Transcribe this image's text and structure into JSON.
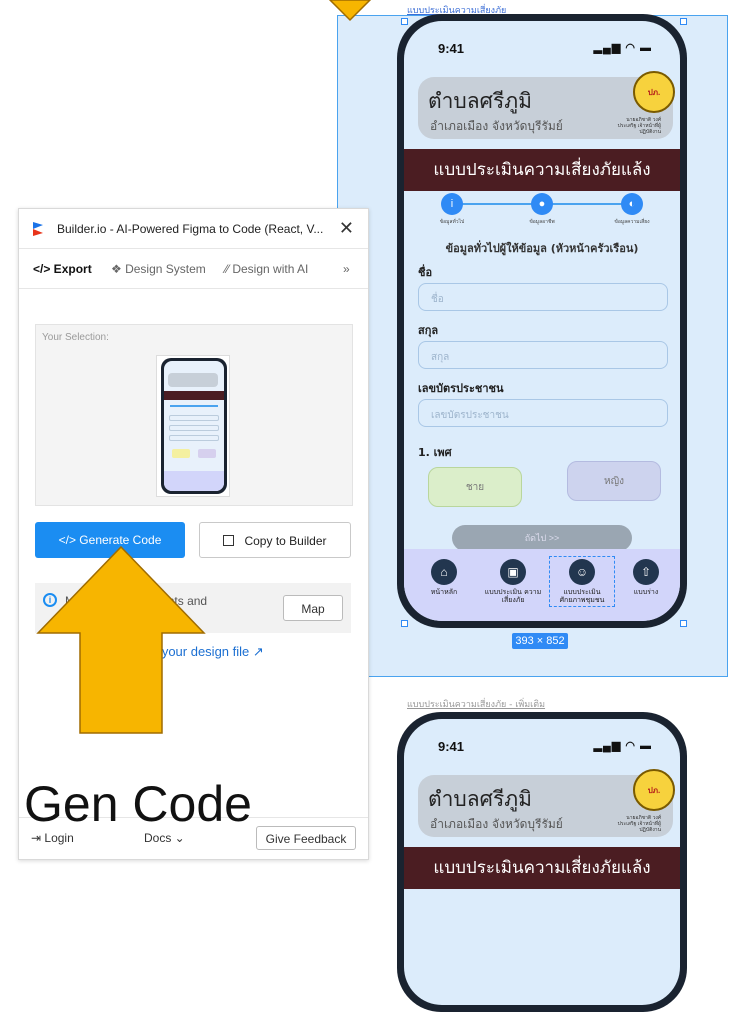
{
  "canvas": {
    "frame1_label": "แบบประเมินความเสี่ยงภัย",
    "frame2_label": "แบบประเมินความเสี่ยงภัย - เพิ่มเติม",
    "dimensions": "393 × 852"
  },
  "phone": {
    "status_time": "9:41",
    "status_icons": "▂▄▆ ◠ ▬",
    "header_title": "ตำบลศรีภูมิ",
    "header_sub": "อำเภอเมือง จังหวัดบุรีรัมย์",
    "header_note": "นายอภิชาติ วงศ์ประเสริฐ เจ้าหน้าที่ผู้ปฏิบัติงาน",
    "logo_text": "ปภ.",
    "banner": "แบบประเมินความเสี่ยงภัยแล้ง",
    "steps": [
      {
        "icon": "i",
        "label": "ข้อมูลทั่วไป"
      },
      {
        "icon": "●",
        "label": "ข้อมูลอาชีพ"
      },
      {
        "icon": "◐",
        "label": "ข้อมูลความเสี่ยง"
      }
    ],
    "form_title": "ข้อมูลทั่วไปผู้ให้ข้อมูล (หัวหน้าครัวเรือน)",
    "fields": [
      {
        "label": "ชื่อ",
        "placeholder": "ชื่อ"
      },
      {
        "label": "สกุล",
        "placeholder": "สกุล"
      },
      {
        "label": "เลขบัตรประชาชน",
        "placeholder": "เลขบัตรประชาชน"
      }
    ],
    "gender_label": "1. เพศ",
    "gender_male": "ชาย",
    "gender_female": "หญิง",
    "next_label": "ถัดไป >>",
    "tabs": [
      {
        "icon": "⌂",
        "label": "หน้าหลัก"
      },
      {
        "icon": "▣",
        "label": "แบบประเมิน ความเสี่ยงภัย"
      },
      {
        "icon": "☺",
        "label": "แบบประเมิน ศักยภาพชุมชน"
      },
      {
        "icon": "⇧",
        "label": "แบบร่าง"
      }
    ]
  },
  "plugin": {
    "title": "Builder.io - AI-Powered Figma to Code (React, V...",
    "close": "✕",
    "tabs": [
      "</> Export",
      "❖ Design System",
      "⁄⁄ Design with AI",
      "»"
    ],
    "selection_label": "Your Selection:",
    "generate_label": "</>   Generate Code",
    "copy_label": "Copy to Builder",
    "info_text": "Map your components and ...designs.",
    "map_label": "Map",
    "setup_link": "Setup your design file ↗",
    "login_label": "⇥ Login",
    "docs_label": "Docs ⌄",
    "feedback_label": "Give Feedback"
  },
  "annotation": {
    "caption": "Gen Code",
    "arrow_color": "#f7b500"
  }
}
